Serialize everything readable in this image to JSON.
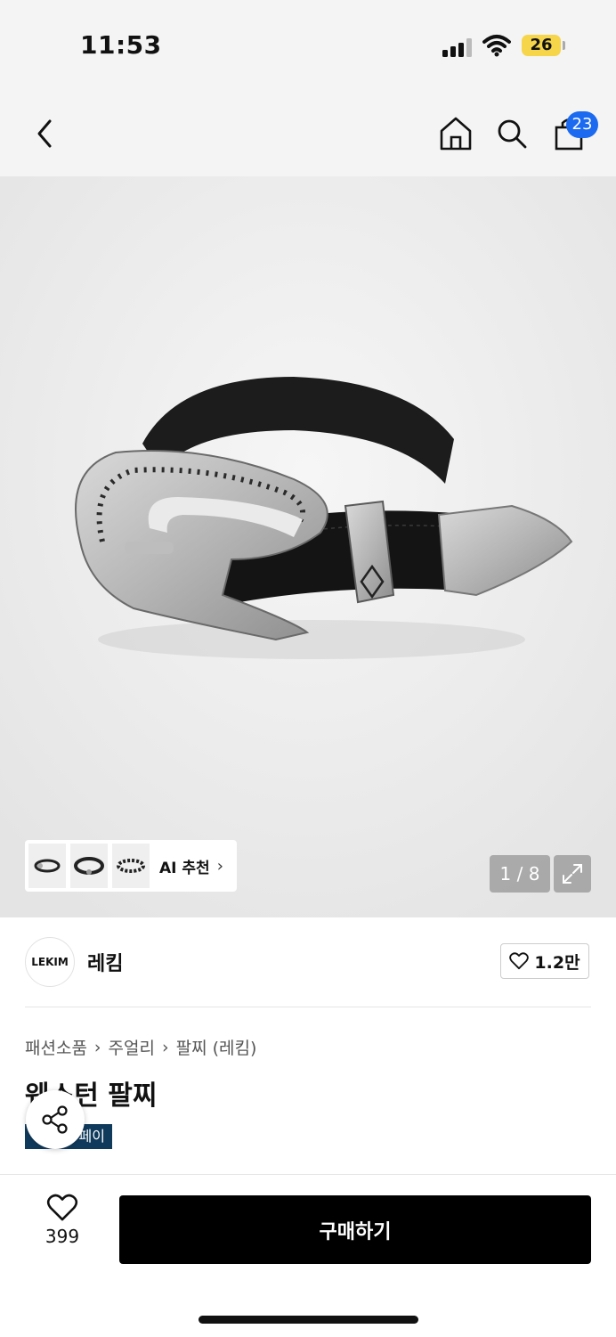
{
  "status_bar": {
    "time": "11:53",
    "battery": "26"
  },
  "nav": {
    "cart_count": "23"
  },
  "gallery": {
    "page_counter": "1 / 8",
    "ai_label": "AI 추천",
    "thumbnails": [
      "bracelet-thumb-1",
      "bracelet-thumb-2",
      "bracelet-thumb-3"
    ]
  },
  "brand": {
    "logo_text": "LEKIM",
    "name": "레킴",
    "likes": "1.2만"
  },
  "product": {
    "breadcrumb": [
      "패션소품",
      "주얼리",
      "팔찌 (레킴)"
    ],
    "title": "웨스턴 팔찌",
    "pay_badge": "페이"
  },
  "bottom": {
    "wish_count": "399",
    "buy_label": "구매하기"
  },
  "colors": {
    "accent": "#1b6af0",
    "buy_button": "#000000",
    "pay_badge": "#0f3a5c"
  }
}
